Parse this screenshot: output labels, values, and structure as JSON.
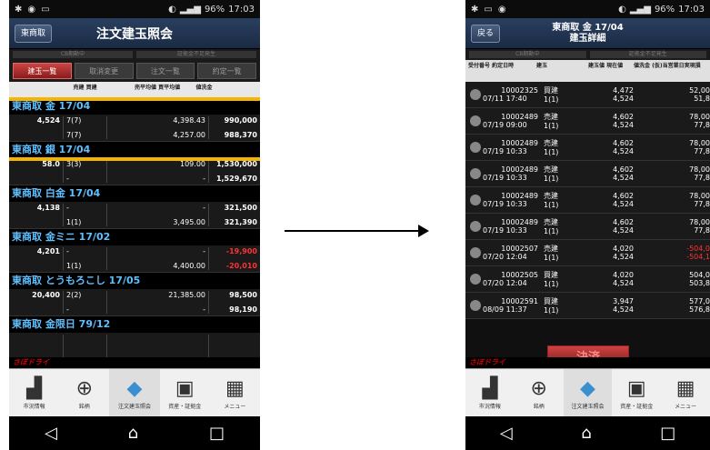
{
  "status1": {
    "time": "17:03",
    "battery": "96%"
  },
  "status2": {
    "time": "17:03",
    "battery": "96%"
  },
  "screen1": {
    "back": "東商取",
    "title": "注文建玉照会",
    "status_left": "CB期動中",
    "status_right": "証拠金不足発生",
    "tabs": [
      "建玉一覧",
      "取消変更",
      "注文一覧",
      "約定一覧"
    ],
    "headers": [
      "",
      "売建 買建",
      "売平均値 買平均値",
      "値洗金"
    ],
    "groups": [
      {
        "name": "東商取 金 17/04",
        "price": "4,524",
        "q1": "7(7)",
        "q2": "7(7)",
        "a1": "4,398.43",
        "a2": "4,257.00",
        "v1": "990,000",
        "v2": "988,370"
      },
      {
        "name": "東商取 銀 17/04",
        "price": "58.0",
        "q1": "3(3)",
        "q2": "-",
        "a1": "109.00",
        "a2": "-",
        "v1": "1,530,000",
        "v2": "1,529,670"
      },
      {
        "name": "東商取 白金 17/04",
        "price": "4,138",
        "q1": "-",
        "q2": "1(1)",
        "a1": "-",
        "a2": "3,495.00",
        "v1": "321,500",
        "v2": "321,390"
      },
      {
        "name": "東商取 金ミニ 17/02",
        "price": "4,201",
        "q1": "-",
        "q2": "1(1)",
        "a1": "-",
        "a2": "4,400.00",
        "v1": "-19,900",
        "v2": "-20,010"
      },
      {
        "name": "東商取 とうもろこし 17/05",
        "price": "20,400",
        "q1": "2(2)",
        "q2": "-",
        "a1": "21,385.00",
        "a2": "-",
        "v1": "98,500",
        "v2": "98,190"
      },
      {
        "name": "東商取 金限日 79/12",
        "price": "",
        "q1": "",
        "q2": "",
        "a1": "",
        "a2": "",
        "v1": "",
        "v2": ""
      }
    ]
  },
  "screen2": {
    "back": "戻る",
    "title1": "東商取 金 17/04",
    "title2": "建玉詳細",
    "status_left": "CB期動中",
    "status_right": "証拠金不足発生",
    "headers": [
      "受付番号 約定日時",
      "建玉",
      "建玉値 現在値",
      "値洗金 (仮)当営業日実現損"
    ],
    "rows": [
      {
        "no": "10002325",
        "date": "07/11 17:40",
        "type": "買建",
        "qty": "1(1)",
        "p1": "4,472",
        "p2": "4,524",
        "v1": "52,00",
        "v2": "51,8"
      },
      {
        "no": "10002489",
        "date": "07/19 09:00",
        "type": "売建",
        "qty": "1(1)",
        "p1": "4,602",
        "p2": "4,524",
        "v1": "78,00",
        "v2": "77,8"
      },
      {
        "no": "10002489",
        "date": "07/19 10:33",
        "type": "売建",
        "qty": "1(1)",
        "p1": "4,602",
        "p2": "4,524",
        "v1": "78,00",
        "v2": "77,8"
      },
      {
        "no": "10002489",
        "date": "07/19 10:33",
        "type": "売建",
        "qty": "1(1)",
        "p1": "4,602",
        "p2": "4,524",
        "v1": "78,00",
        "v2": "77,8"
      },
      {
        "no": "10002489",
        "date": "07/19 10:33",
        "type": "売建",
        "qty": "1(1)",
        "p1": "4,602",
        "p2": "4,524",
        "v1": "78,00",
        "v2": "77,8"
      },
      {
        "no": "10002489",
        "date": "07/19 10:33",
        "type": "売建",
        "qty": "1(1)",
        "p1": "4,602",
        "p2": "4,524",
        "v1": "78,00",
        "v2": "77,8"
      },
      {
        "no": "10002507",
        "date": "07/20 12:04",
        "type": "売建",
        "qty": "1(1)",
        "p1": "4,020",
        "p2": "4,524",
        "v1": "-504,0",
        "v2": "-504,1"
      },
      {
        "no": "10002505",
        "date": "07/20 12:04",
        "type": "買建",
        "qty": "1(1)",
        "p1": "4,020",
        "p2": "4,524",
        "v1": "504,0",
        "v2": "503,8"
      },
      {
        "no": "10002591",
        "date": "08/09 11:37",
        "type": "買建",
        "qty": "1(1)",
        "p1": "3,947",
        "p2": "4,524",
        "v1": "577,0",
        "v2": "576,8"
      }
    ],
    "settle": "決済"
  },
  "nav": [
    "市況情報",
    "銘柄",
    "注文建玉照会",
    "資産・証拠金",
    "メニュー"
  ]
}
